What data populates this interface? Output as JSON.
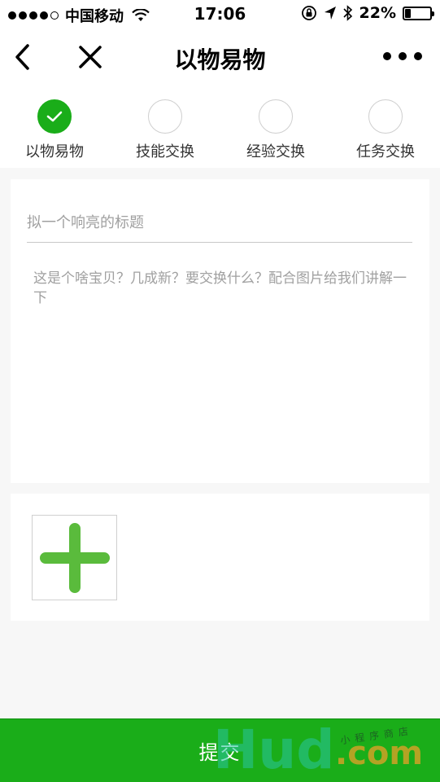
{
  "status_bar": {
    "carrier": "中国移动",
    "time": "17:06",
    "battery": "22%",
    "battery_level": 0.22,
    "icons": [
      "signal-dots",
      "wifi-icon",
      "orientation-lock-icon",
      "location-arrow-icon",
      "bluetooth-icon",
      "battery-icon"
    ]
  },
  "nav": {
    "title": "以物易物",
    "icons": [
      "back-chevron-icon",
      "close-icon",
      "more-icon"
    ]
  },
  "tabs": [
    {
      "label": "以物易物",
      "checked": true
    },
    {
      "label": "技能交换",
      "checked": false
    },
    {
      "label": "经验交换",
      "checked": false
    },
    {
      "label": "任务交换",
      "checked": false
    }
  ],
  "form": {
    "title_placeholder": "拟一个响亮的标题",
    "title_value": "",
    "desc_placeholder": "这是个啥宝贝？几成新？要交换什么？配合图片给我们讲解一下",
    "desc_value": ""
  },
  "images": {
    "add_icon": "plus-icon"
  },
  "submit": {
    "label": "提交"
  },
  "watermark": {
    "brand": "Hud",
    "domain": ".com",
    "tagline": "小程序商店"
  },
  "colors": {
    "accent": "#1aad19",
    "plus": "#5abb3c",
    "placeholder": "#a0a0a0"
  }
}
